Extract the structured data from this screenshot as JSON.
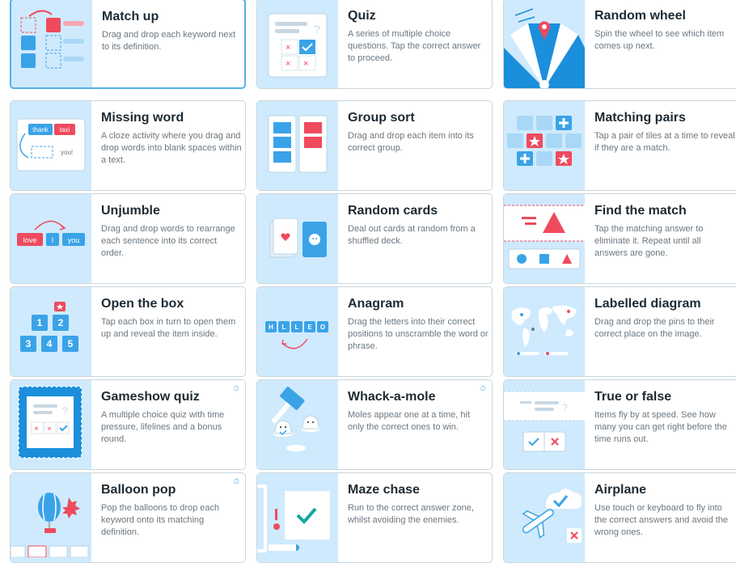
{
  "templates": [
    {
      "name": "Match up",
      "desc": "Drag and drop each keyword next to its definition.",
      "icon": "match-up-icon"
    },
    {
      "name": "Quiz",
      "desc": "A series of multiple choice questions. Tap the correct answer to proceed.",
      "icon": "quiz-icon"
    },
    {
      "name": "Random wheel",
      "desc": "Spin the wheel to see which item comes up next.",
      "icon": "random-wheel-icon"
    },
    {
      "name": "Missing word",
      "desc": "A cloze activity where you drag and drop words into blank spaces within a text.",
      "icon": "missing-word-icon",
      "chips": [
        "thank",
        "taxi",
        "you!"
      ]
    },
    {
      "name": "Group sort",
      "desc": "Drag and drop each item into its correct group.",
      "icon": "group-sort-icon"
    },
    {
      "name": "Matching pairs",
      "desc": "Tap a pair of tiles at a time to reveal if they are a match.",
      "icon": "matching-pairs-icon"
    },
    {
      "name": "Unjumble",
      "desc": "Drag and drop words to rearrange each sentence into its correct order.",
      "icon": "unjumble-icon",
      "chips": [
        "love",
        "I",
        "you"
      ]
    },
    {
      "name": "Random cards",
      "desc": "Deal out cards at random from a shuffled deck.",
      "icon": "random-cards-icon"
    },
    {
      "name": "Find the match",
      "desc": "Tap the matching answer to eliminate it. Repeat until all answers are gone.",
      "icon": "find-the-match-icon"
    },
    {
      "name": "Open the box",
      "desc": "Tap each box in turn to open them up and reveal the item inside.",
      "icon": "open-the-box-icon",
      "chips": [
        "1",
        "2",
        "3",
        "4",
        "5"
      ]
    },
    {
      "name": "Anagram",
      "desc": "Drag the letters into their correct positions to unscramble the word or phrase.",
      "icon": "anagram-icon",
      "chips": [
        "H",
        "L",
        "L",
        "E",
        "O"
      ]
    },
    {
      "name": "Labelled diagram",
      "desc": "Drag and drop the pins to their correct place on the image.",
      "icon": "labelled-diagram-icon"
    },
    {
      "name": "Gameshow quiz",
      "desc": "A multiple choice quiz with time pressure, lifelines and a bonus round.",
      "icon": "gameshow-quiz-icon"
    },
    {
      "name": "Whack-a-mole",
      "desc": "Moles appear one at a time, hit only the correct ones to win.",
      "icon": "whack-a-mole-icon"
    },
    {
      "name": "True or false",
      "desc": "Items fly by at speed. See how many you can get right before the time runs out.",
      "icon": "true-or-false-icon"
    },
    {
      "name": "Balloon pop",
      "desc": "Pop the balloons to drop each keyword onto its matching definition.",
      "icon": "balloon-pop-icon"
    },
    {
      "name": "Maze chase",
      "desc": "Run to the correct answer zone, whilst avoiding the enemies.",
      "icon": "maze-chase-icon"
    },
    {
      "name": "Airplane",
      "desc": "Use touch or keyboard to fly into the correct answers and avoid the wrong ones.",
      "icon": "airplane-icon"
    }
  ],
  "timer_glyph": "⏱"
}
